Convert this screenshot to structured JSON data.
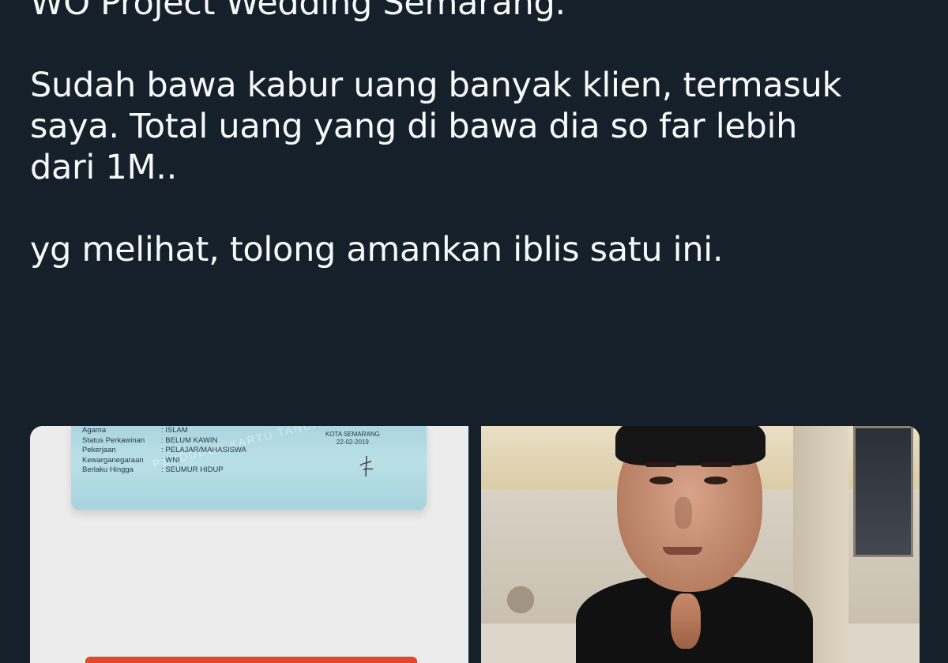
{
  "tweet": {
    "line1": "WO Project Wedding Semarang.",
    "para2": "Sudah bawa kabur uang banyak klien, termasuk\nsaya. Total uang yang di bawa dia so far lebih\ndari 1M..",
    "para3": "yg melihat, tolong amankan iblis satu ini."
  },
  "media": {
    "id_card": {
      "rows": [
        {
          "label": "Agama",
          "value": ": ISLAM"
        },
        {
          "label": "Status Perkawinan",
          "value": ": BELUM KAWIN"
        },
        {
          "label": "Pekerjaan",
          "value": ": PELAJAR/MAHASISWA"
        },
        {
          "label": "Kewarganegaraan",
          "value": ": WNI"
        },
        {
          "label": "Berlaku Hingga",
          "value": ": SEUMUR HIDUP"
        }
      ],
      "issued_city": "KOTA SEMARANG",
      "issued_date": "22-02-2019",
      "watermark": "PENDUDUK KARTU TANDA"
    }
  },
  "colors": {
    "background": "#15202b",
    "text": "#f7f9f9"
  }
}
